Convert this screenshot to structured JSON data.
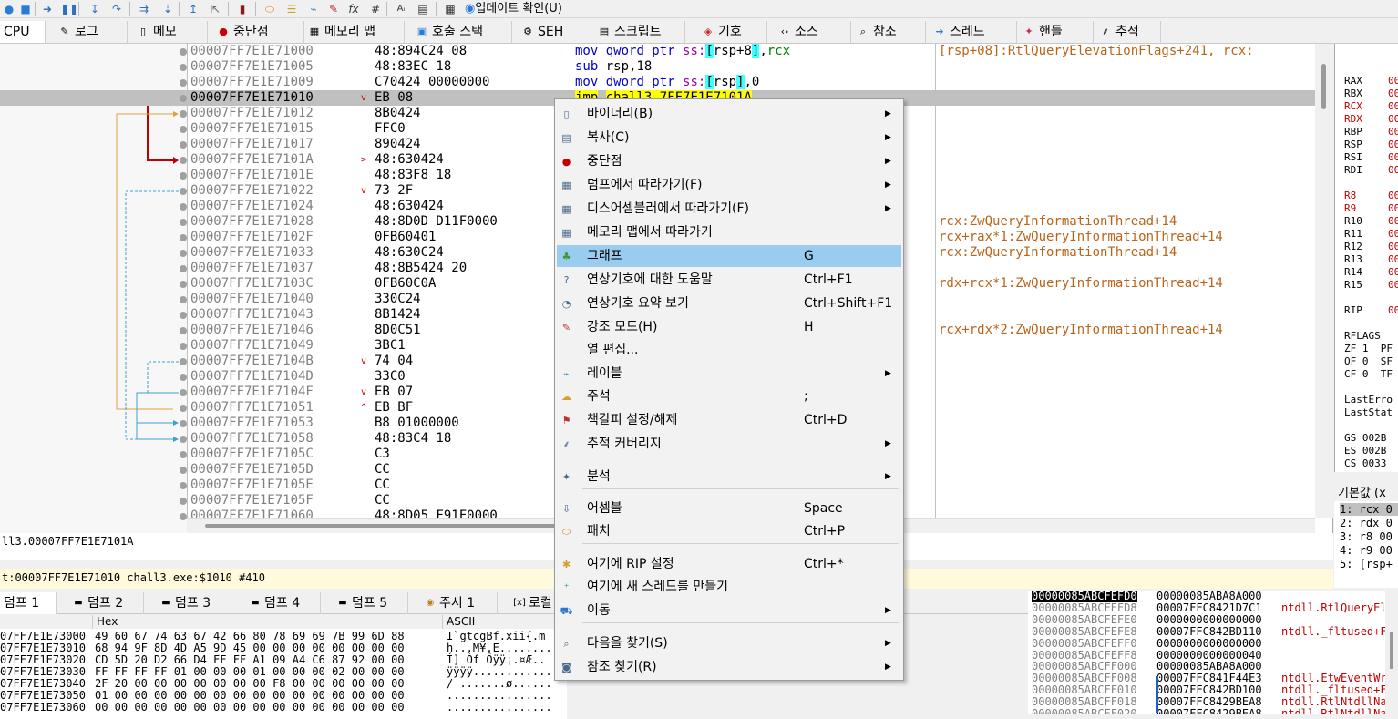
{
  "toolbar": {
    "update_label": "업데이트 확인(U)"
  },
  "tabs": [
    {
      "label": "CPU",
      "icon": "cpu-icon"
    },
    {
      "label": "로그",
      "icon": "log-icon"
    },
    {
      "label": "메모",
      "icon": "notes-icon"
    },
    {
      "label": "중단점",
      "icon": "breakpoint-icon"
    },
    {
      "label": "메모리 맵",
      "icon": "memory-map-icon"
    },
    {
      "label": "호출 스택",
      "icon": "call-stack-icon"
    },
    {
      "label": "SEH",
      "icon": "seh-icon"
    },
    {
      "label": "스크립트",
      "icon": "script-icon"
    },
    {
      "label": "기호",
      "icon": "symbols-icon"
    },
    {
      "label": "소스",
      "icon": "source-icon"
    },
    {
      "label": "참조",
      "icon": "references-icon"
    },
    {
      "label": "스레드",
      "icon": "threads-icon"
    },
    {
      "label": "핸들",
      "icon": "handles-icon"
    },
    {
      "label": "추적",
      "icon": "trace-icon"
    }
  ],
  "disasm": {
    "rows": [
      {
        "addr": "00007FF7E1E71000",
        "bytes": "48:894C24 08",
        "arrow": ""
      },
      {
        "addr": "00007FF7E1E71005",
        "bytes": "48:83EC 18",
        "arrow": ""
      },
      {
        "addr": "00007FF7E1E71009",
        "bytes": "C70424 00000000",
        "arrow": ""
      },
      {
        "addr": "00007FF7E1E71010",
        "bytes": "EB 08",
        "arrow": "v"
      },
      {
        "addr": "00007FF7E1E71012",
        "bytes": "8B0424",
        "arrow": ""
      },
      {
        "addr": "00007FF7E1E71015",
        "bytes": "FFC0",
        "arrow": ""
      },
      {
        "addr": "00007FF7E1E71017",
        "bytes": "890424",
        "arrow": ""
      },
      {
        "addr": "00007FF7E1E7101A",
        "bytes": "48:630424",
        "arrow": ">"
      },
      {
        "addr": "00007FF7E1E7101E",
        "bytes": "48:83F8 18",
        "arrow": ""
      },
      {
        "addr": "00007FF7E1E71022",
        "bytes": "73 2F",
        "arrow": "v"
      },
      {
        "addr": "00007FF7E1E71024",
        "bytes": "48:630424",
        "arrow": ""
      },
      {
        "addr": "00007FF7E1E71028",
        "bytes": "48:8D0D D11F0000",
        "arrow": ""
      },
      {
        "addr": "00007FF7E1E7102F",
        "bytes": "0FB60401",
        "arrow": ""
      },
      {
        "addr": "00007FF7E1E71033",
        "bytes": "48:630C24",
        "arrow": ""
      },
      {
        "addr": "00007FF7E1E71037",
        "bytes": "48:8B5424 20",
        "arrow": ""
      },
      {
        "addr": "00007FF7E1E7103C",
        "bytes": "0FB60C0A",
        "arrow": ""
      },
      {
        "addr": "00007FF7E1E71040",
        "bytes": "330C24",
        "arrow": ""
      },
      {
        "addr": "00007FF7E1E71043",
        "bytes": "8B1424",
        "arrow": ""
      },
      {
        "addr": "00007FF7E1E71046",
        "bytes": "8D0C51",
        "arrow": ""
      },
      {
        "addr": "00007FF7E1E71049",
        "bytes": "3BC1",
        "arrow": ""
      },
      {
        "addr": "00007FF7E1E7104B",
        "bytes": "74 04",
        "arrow": "v"
      },
      {
        "addr": "00007FF7E1E7104D",
        "bytes": "33C0",
        "arrow": ""
      },
      {
        "addr": "00007FF7E1E7104F",
        "bytes": "EB 07",
        "arrow": "v"
      },
      {
        "addr": "00007FF7E1E71051",
        "bytes": "EB BF",
        "arrow": "^"
      },
      {
        "addr": "00007FF7E1E71053",
        "bytes": "B8 01000000",
        "arrow": ""
      },
      {
        "addr": "00007FF7E1E71058",
        "bytes": "48:83C4 18",
        "arrow": ""
      },
      {
        "addr": "00007FF7E1E7105C",
        "bytes": "C3",
        "arrow": ""
      },
      {
        "addr": "00007FF7E1E7105D",
        "bytes": "CC",
        "arrow": ""
      },
      {
        "addr": "00007FF7E1E7105E",
        "bytes": "CC",
        "arrow": ""
      },
      {
        "addr": "00007FF7E1E7105F",
        "bytes": "CC",
        "arrow": ""
      },
      {
        "addr": "00007FF7E1E71060",
        "bytes": "48:8D05 F91F0000",
        "arrow": ""
      }
    ],
    "instructions": {
      "i0_mnem": "mov",
      "i0_ptr": "qword ptr",
      "i0_seg": "ss:",
      "i0_mem": "rsp+8",
      "i0_reg": "rcx",
      "i1_mnem": "sub",
      "i1_ops": "rsp,18",
      "i2_mnem": "mov",
      "i2_ptr": "dword ptr",
      "i2_seg": "ss:",
      "i2_mem": "rsp",
      "i2_val": ",0",
      "i3_mnem": "jmp",
      "i3_target": "chall3.7FF7E1E7101A"
    },
    "comments": [
      "[rsp+08]:RtlQueryElevationFlags+241, rcx:",
      "rcx:ZwQueryInformationThread+14",
      "rcx+rax*1:ZwQueryInformationThread+14",
      "rcx:ZwQueryInformationThread+14",
      "rdx+rcx*1:ZwQueryInformationThread+14",
      "rcx+rdx*2:ZwQueryInformationThread+14"
    ]
  },
  "registers": {
    "gp": [
      "RAX",
      "RBX",
      "RCX",
      "RDX",
      "RBP",
      "RSP",
      "RSI",
      "RDI"
    ],
    "ext": [
      "R8",
      "R9",
      "R10",
      "R11",
      "R12",
      "R13",
      "R14",
      "R15"
    ],
    "rip": "RIP",
    "rflags": "RFLAGS",
    "flags": [
      "ZF 1  PF",
      "OF 0  SF",
      "CF 0  TF"
    ],
    "last": [
      "LastErro",
      "LastStat"
    ],
    "segs": [
      "GS 002B",
      "ES 002B",
      "CS 0033"
    ],
    "value_prefix": "00"
  },
  "args": {
    "header": "기본값 (x",
    "items": [
      "1: rcx 0",
      "2: rdx 0",
      "3: r8 00",
      "4: r9 00",
      "5: [rsp+"
    ]
  },
  "info": {
    "line1": "ll3.00007FF7E1E7101A",
    "status": "t:00007FF7E1E71010 chall3.exe:$1010 #410"
  },
  "dump_tabs": [
    {
      "label": "덤프 1",
      "icon": "dump-icon"
    },
    {
      "label": "덤프 2",
      "icon": "dump-icon"
    },
    {
      "label": "덤프 3",
      "icon": "dump-icon"
    },
    {
      "label": "덤프 4",
      "icon": "dump-icon"
    },
    {
      "label": "덤프 5",
      "icon": "dump-icon"
    },
    {
      "label": "주시 1",
      "icon": "watch-icon"
    },
    {
      "label": "로컬",
      "icon": "locals-icon"
    }
  ],
  "dump": {
    "hex_header": "Hex",
    "ascii_header": "ASCII",
    "rows": [
      {
        "addr": "07FF7E1E73000",
        "hex": "49 60 67 74 63 67 42 66 80 78 69 69 7B 99 6D 88",
        "ascii": "I`gtcgBf.xii{.m"
      },
      {
        "addr": "07FF7E1E73010",
        "hex": "68 94 9F 8D 4D A5 9D 45 00 00 00 00 00 00 00 00",
        "ascii": "h...M¥.E........"
      },
      {
        "addr": "07FF7E1E73020",
        "hex": "CD 5D 20 D2 66 D4 FF FF A1 09 A4 C6 87 92 00 00",
        "ascii": "Í] Òf Ôÿÿ¡.¤Æ.."
      },
      {
        "addr": "07FF7E1E73030",
        "hex": "FF FF FF FF 01 00 00 00 01 00 00 00 02 00 00 00",
        "ascii": "ÿÿÿÿ............"
      },
      {
        "addr": "07FF7E1E73040",
        "hex": "2F 20 00 00 00 00 00 00 00 F8 00 00 00 00 00 00",
        "ascii": "/ .......ø......"
      },
      {
        "addr": "07FF7E1E73050",
        "hex": "01 00 00 00 00 00 00 00 00 00 00 00 00 00 00 00",
        "ascii": "................"
      },
      {
        "addr": "07FF7E1E73060",
        "hex": "00 00 00 00 00 00 00 00 00 00 00 00 00 00 00 00",
        "ascii": "................"
      }
    ]
  },
  "stack": {
    "rows": [
      {
        "addr": "00000085ABCFEFD0",
        "val": "00000085ABA8A000",
        "cmt": ""
      },
      {
        "addr": "00000085ABCFEFD8",
        "val": "00007FFC8421D7C1",
        "cmt": "ntdll.RtlQueryEl"
      },
      {
        "addr": "00000085ABCFEFE0",
        "val": "0000000000000000",
        "cmt": ""
      },
      {
        "addr": "00000085ABCFEFE8",
        "val": "00007FFC842BD110",
        "cmt": "ntdll._fltused+F"
      },
      {
        "addr": "00000085ABCFEFF0",
        "val": "0000000000000000",
        "cmt": ""
      },
      {
        "addr": "00000085ABCFEFF8",
        "val": "0000000000000040",
        "cmt": ""
      },
      {
        "addr": "00000085ABCFF000",
        "val": "00000085ABA8A000",
        "cmt": ""
      },
      {
        "addr": "00000085ABCFF008",
        "val": "00007FFC841F44E3",
        "cmt": "ntdll.EtwEventWr"
      },
      {
        "addr": "00000085ABCFF010",
        "val": "00007FFC842BD100",
        "cmt": "ntdll._fltused+F"
      },
      {
        "addr": "00000085ABCFF018",
        "val": "00007FFC8429BEA8",
        "cmt": "ntdll.RtlNtdllNa"
      },
      {
        "addr": "00000085ABCFF020",
        "val": "00007FFC8429BEA8",
        "cmt": "ntdll.RtlNtdllNa"
      }
    ]
  },
  "context_menu": {
    "items": [
      {
        "label": "바이너리(B)",
        "shortcut": "",
        "submenu": true,
        "icon": "binary-icon"
      },
      {
        "label": "복사(C)",
        "shortcut": "",
        "submenu": true,
        "icon": "copy-icon"
      },
      {
        "label": "중단점",
        "shortcut": "",
        "submenu": true,
        "icon": "breakpoint-dot-icon"
      },
      {
        "label": "덤프에서 따라가기(F)",
        "shortcut": "",
        "submenu": true,
        "icon": "follow-dump-icon"
      },
      {
        "label": "디스어셈블러에서 따라가기(F)",
        "shortcut": "",
        "submenu": true,
        "icon": "follow-disasm-icon"
      },
      {
        "label": "메모리 맵에서 따라가기",
        "shortcut": "",
        "submenu": false,
        "icon": "follow-memmap-icon"
      },
      {
        "label": "그래프",
        "shortcut": "G",
        "submenu": false,
        "icon": "graph-icon"
      },
      {
        "label": "연상기호에 대한 도움말",
        "shortcut": "Ctrl+F1",
        "submenu": false,
        "icon": "help-icon"
      },
      {
        "label": "연상기호 요약 보기",
        "shortcut": "Ctrl+Shift+F1",
        "submenu": false,
        "icon": "summary-icon"
      },
      {
        "label": "강조 모드(H)",
        "shortcut": "H",
        "submenu": false,
        "icon": "highlight-icon"
      },
      {
        "label": "열 편집...",
        "shortcut": "",
        "submenu": false,
        "icon": ""
      },
      {
        "label": "레이블",
        "shortcut": "",
        "submenu": true,
        "icon": "label-icon"
      },
      {
        "label": "주석",
        "shortcut": ";",
        "submenu": false,
        "icon": "comment-icon"
      },
      {
        "label": "책갈피 설정/해제",
        "shortcut": "Ctrl+D",
        "submenu": false,
        "icon": "bookmark-icon"
      },
      {
        "label": "추적 커버리지",
        "shortcut": "",
        "submenu": true,
        "icon": "trace-coverage-icon"
      },
      {
        "label": "분석",
        "shortcut": "",
        "submenu": true,
        "icon": "analysis-icon"
      },
      {
        "label": "어셈블",
        "shortcut": "Space",
        "submenu": false,
        "icon": "assemble-icon"
      },
      {
        "label": "패치",
        "shortcut": "Ctrl+P",
        "submenu": false,
        "icon": "patch-icon"
      },
      {
        "label": "여기에 RIP 설정",
        "shortcut": "Ctrl+*",
        "submenu": false,
        "icon": "set-rip-icon"
      },
      {
        "label": "여기에 새 스레드를 만들기",
        "shortcut": "",
        "submenu": false,
        "icon": "new-thread-icon"
      },
      {
        "label": "이동",
        "shortcut": "",
        "submenu": true,
        "icon": "goto-icon"
      },
      {
        "label": "다음을 찾기(S)",
        "shortcut": "",
        "submenu": true,
        "icon": "search-icon"
      },
      {
        "label": "참조 찾기(R)",
        "shortcut": "",
        "submenu": true,
        "icon": "find-refs-icon"
      }
    ]
  },
  "colors": {
    "accent": "#99ccee",
    "comment": "#b8651a",
    "selected_row": "#c0c0c0",
    "jump_red": "#c00000",
    "jump_orange": "#e0a040",
    "jump_blue": "#3ca0d0"
  }
}
